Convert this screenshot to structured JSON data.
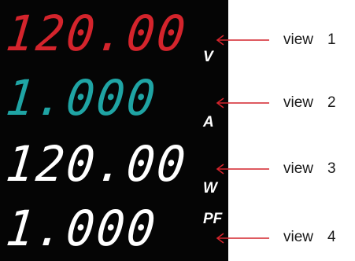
{
  "rows": [
    {
      "reading": "120.00",
      "unit": "V",
      "caption": "view",
      "number": "1",
      "color": "#d4242c"
    },
    {
      "reading": "1.000",
      "unit": "A",
      "caption": "view",
      "number": "2",
      "color": "#1fa4a4"
    },
    {
      "reading": "120.00",
      "unit": "W",
      "caption": "view",
      "number": "3",
      "color": "#ffffff"
    },
    {
      "reading": "1.000",
      "unit": "PF",
      "caption": "view",
      "number": "4",
      "color": "#ffffff"
    }
  ],
  "arrow_color": "#d4242c",
  "panel_color": "#050505"
}
